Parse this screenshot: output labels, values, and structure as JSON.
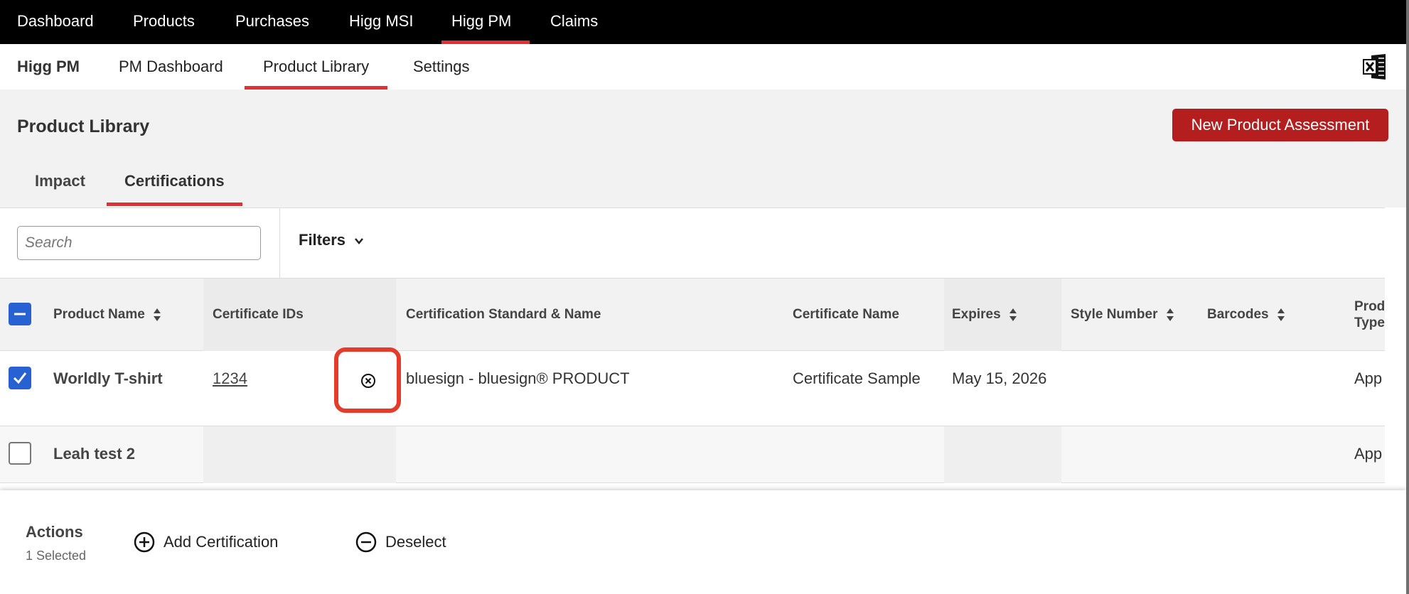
{
  "top_nav": {
    "items": [
      {
        "label": "Dashboard",
        "active": false
      },
      {
        "label": "Products",
        "active": false
      },
      {
        "label": "Purchases",
        "active": false
      },
      {
        "label": "Higg MSI",
        "active": false
      },
      {
        "label": "Higg PM",
        "active": true
      },
      {
        "label": "Claims",
        "active": false
      }
    ]
  },
  "sub_nav": {
    "brand": "Higg PM",
    "items": [
      {
        "label": "PM Dashboard",
        "active": false
      },
      {
        "label": "Product Library",
        "active": true
      },
      {
        "label": "Settings",
        "active": false
      }
    ],
    "export_icon": "excel-icon"
  },
  "header": {
    "title": "Product Library",
    "primary_button": "New Product Assessment"
  },
  "tabs": [
    {
      "label": "Impact",
      "active": false
    },
    {
      "label": "Certifications",
      "active": true
    }
  ],
  "toolbar": {
    "search_placeholder": "Search",
    "filters_label": "Filters"
  },
  "table": {
    "columns": [
      {
        "label": "Product Name",
        "sortable": true
      },
      {
        "label": "Certificate IDs",
        "sortable": false
      },
      {
        "label": "Certification Standard & Name",
        "sortable": false
      },
      {
        "label": "Certificate Name",
        "sortable": false
      },
      {
        "label": "Expires",
        "sortable": true
      },
      {
        "label": "Style Number",
        "sortable": true
      },
      {
        "label": "Barcodes",
        "sortable": true
      },
      {
        "label": "Prod Type",
        "sortable": false
      }
    ],
    "rows": [
      {
        "checked": true,
        "product_name": "Worldly T-shirt",
        "certificate_id": "1234",
        "standard_name": "bluesign - bluesign® PRODUCT",
        "certificate_name": "Certificate Sample",
        "expires": "May 15, 2026",
        "style_number": "",
        "barcodes": "",
        "product_type": "App"
      },
      {
        "checked": false,
        "product_name": "Leah test 2",
        "certificate_id": "",
        "standard_name": "",
        "certificate_name": "",
        "expires": "",
        "style_number": "",
        "barcodes": "",
        "product_type": "App"
      }
    ]
  },
  "actions": {
    "title": "Actions",
    "selected_text": "1 Selected",
    "add_certification": "Add Certification",
    "deselect": "Deselect"
  },
  "colors": {
    "accent_red": "#e03232",
    "button_red": "#b41e1e",
    "checkbox_blue": "#2862d2",
    "highlight": "#e43b2a"
  }
}
